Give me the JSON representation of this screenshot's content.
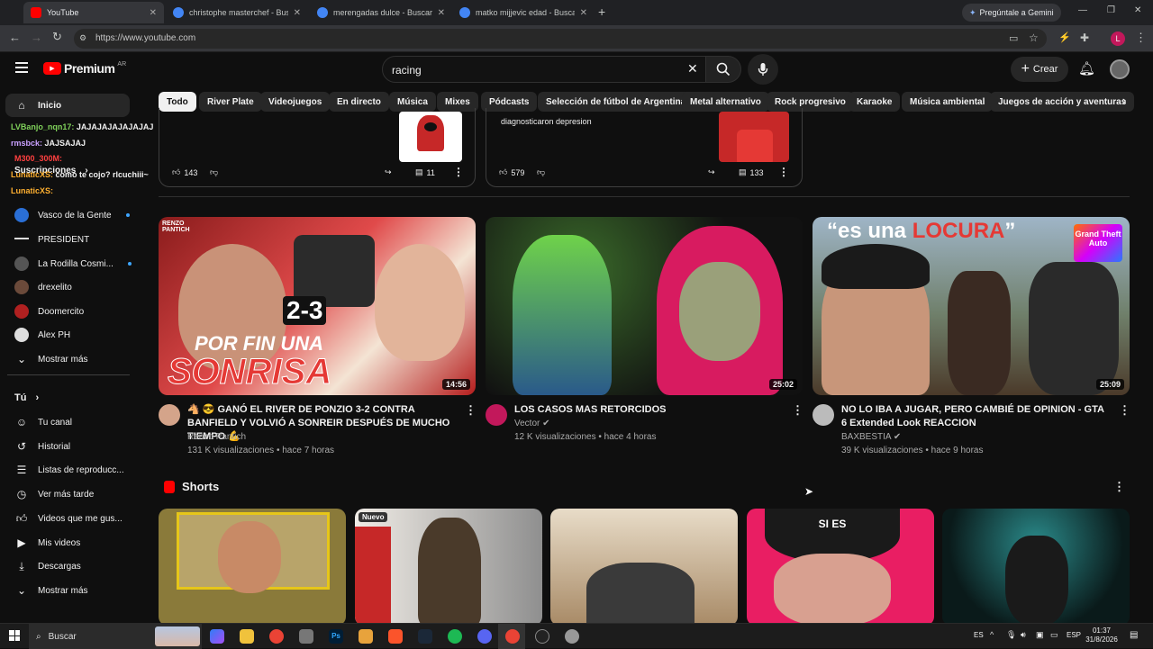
{
  "browser": {
    "tabs": [
      {
        "title": "YouTube",
        "favicon_color": "#ff0000"
      },
      {
        "title": "christophe masterchef - Buscar",
        "favicon_color": "#4285f4"
      },
      {
        "title": "merengadas dulce - Buscar con",
        "favicon_color": "#4285f4"
      },
      {
        "title": "matko mijjevic edad - Buscar c",
        "favicon_color": "#4285f4"
      }
    ],
    "gemini_label": "Pregúntale a Gemini",
    "url": "https://www.youtube.com",
    "profile_initial": "L"
  },
  "header": {
    "logo": "Premium",
    "region": "AR",
    "search_value": "racing",
    "create_label": "Crear"
  },
  "chips": [
    "Todo",
    "River Plate",
    "Videojuegos",
    "En directo",
    "Música",
    "Mixes",
    "Pódcasts",
    "Selección de fútbol de Argentina",
    "Metal alternativo",
    "Rock progresivo",
    "Karaoke",
    "Música ambiental",
    "Juegos de acción y aventuras"
  ],
  "sidebar": {
    "home": "Inicio",
    "subscriptions_label": "Suscripciones",
    "channels": [
      {
        "name": "Vasco de la Gente",
        "live_dot": true,
        "color": "#2a6fd6"
      },
      {
        "name": "PRESIDENT",
        "live_dot": false,
        "color": "#111111"
      },
      {
        "name": "La Rodilla Cosmi...",
        "live_dot": true,
        "color": "#555555"
      },
      {
        "name": "drexelito",
        "live_dot": false,
        "color": "#6b4a3a"
      },
      {
        "name": "Doomercito",
        "live_dot": false,
        "color": "#b02020"
      },
      {
        "name": "Alex PH",
        "live_dot": false,
        "color": "#dddddd"
      }
    ],
    "show_more": "Mostrar más",
    "you_label": "Tú",
    "you_items": [
      "Tu canal",
      "Historial",
      "Listas de reproducc...",
      "Ver más tarde",
      "Videos que me gus...",
      "Mis videos",
      "Descargas",
      "Mostrar más"
    ]
  },
  "chat_overlay": [
    {
      "user": "LVBanjo_nqn17:",
      "msg": "JAJAJAJAJAJAJAJ",
      "color": "#7fd05a"
    },
    {
      "user": "rmsbck:",
      "msg": "JAJSAJAJ",
      "color": "#c9a0ff"
    },
    {
      "user": "M300_300M:",
      "msg": "",
      "color": "#ff4040"
    },
    {
      "user": "LunaticXS:",
      "msg": "como te cojo? rlcuchiii~",
      "color": "#ffb030"
    },
    {
      "user": "LunaticXS:",
      "msg": "",
      "color": "#ffb030"
    }
  ],
  "posts": [
    {
      "snippet": "",
      "likes": "143",
      "comments": "11"
    },
    {
      "snippet": "diagnosticaron depresion",
      "likes": "579",
      "comments": "133"
    }
  ],
  "videos": [
    {
      "title": "🐴 😎 GANÓ EL RIVER DE PONZIO 3-2 CONTRA BANFIELD Y VOLVIÓ A SONREIR DESPUÉS DE MUCHO TIEMPO 💪",
      "channel": "Renzo Pantich",
      "meta": "131 K visualizaciones • hace 7 horas",
      "duration": "14:56",
      "thumb_text_1": "POR FIN UNA",
      "thumb_text_2": "SONRISA",
      "thumb_score": "2-3",
      "thumb_tag": "RENZO PANTICH"
    },
    {
      "title": "LOS CASOS MAS RETORCIDOS",
      "channel": "Vector",
      "meta": "12 K visualizaciones • hace 4 horas",
      "duration": "25:02"
    },
    {
      "title": "NO LO IBA A JUGAR, PERO CAMBIÉ DE OPINION - GTA 6 Extended Look REACCION",
      "channel": "BAXBESTIA",
      "meta": "39 K visualizaciones • hace 9 horas",
      "duration": "25:09",
      "thumb_text_1": "“es una ",
      "thumb_text_2": "LOCURA",
      "thumb_text_3": "”",
      "thumb_logo": "Grand Theft Auto"
    }
  ],
  "shorts": {
    "heading": "Shorts",
    "badge": "Nuevo",
    "cap_text": "SI ES"
  },
  "taskbar": {
    "search": "Buscar",
    "lang1": "ES",
    "lang2": "ESP",
    "time": "01:37",
    "date": "31/8/2026"
  }
}
